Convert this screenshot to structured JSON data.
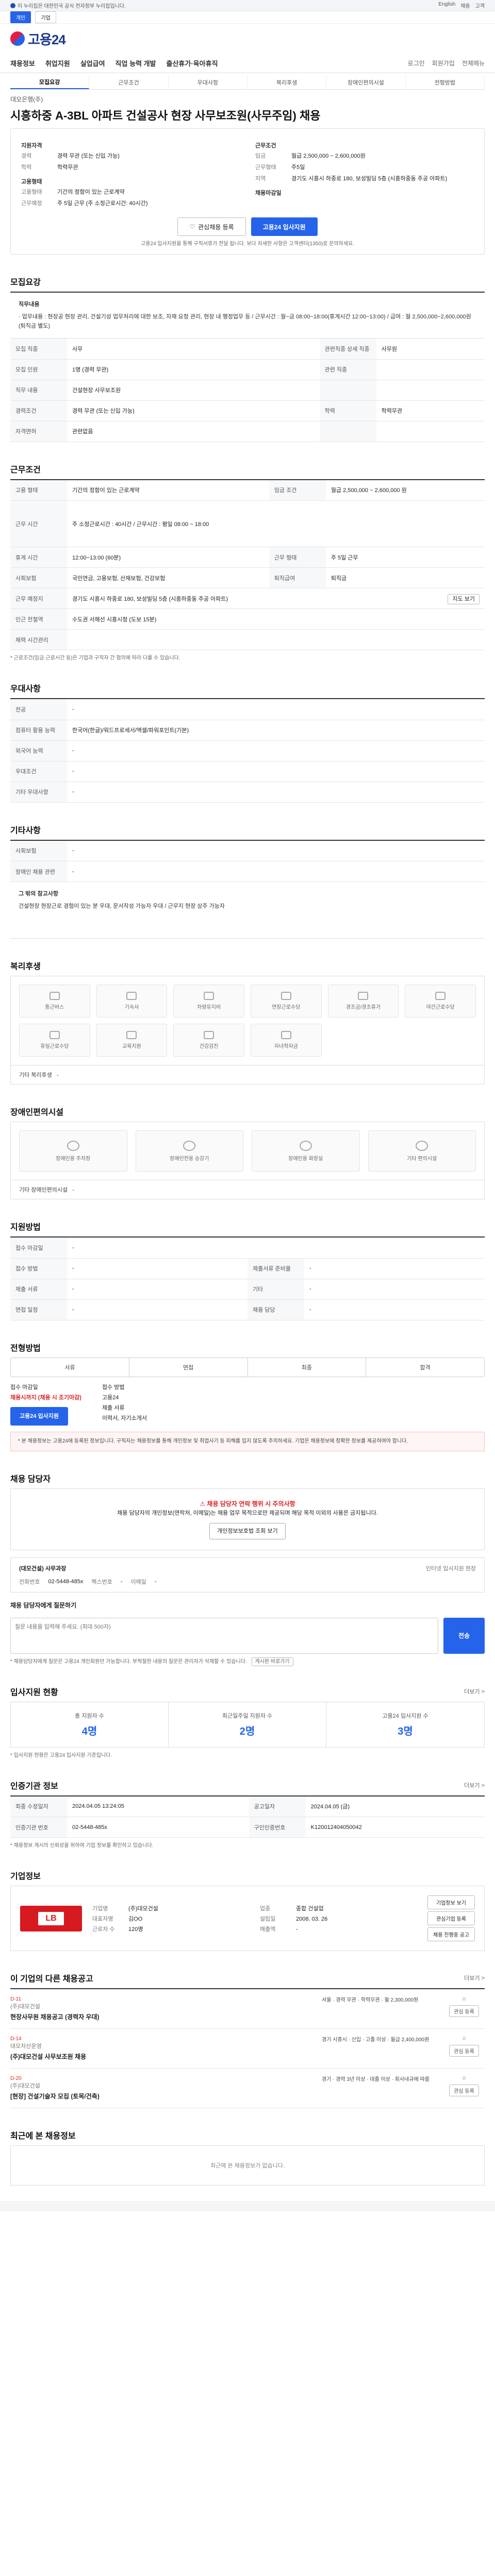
{
  "topbar": {
    "text": "이 누리집은 대한민국 공식 전자정부 누리집입니다.",
    "links": [
      "English",
      "채용",
      "고객"
    ]
  },
  "util": {
    "tabs": [
      "개인",
      "기업"
    ]
  },
  "brand": {
    "name": "고용24"
  },
  "gnb": {
    "items": [
      "채용정보",
      "취업지원",
      "실업급여",
      "직업 능력 개발",
      "출산휴가·육아휴직"
    ],
    "right": [
      "로그인",
      "회원가입",
      "전체메뉴"
    ]
  },
  "tabs": [
    "모집요강",
    "근무조건",
    "우대사항",
    "복리후생",
    "장애인편의시설",
    "전형방법"
  ],
  "job": {
    "company": "대모은행(주)",
    "title": "시흥하중 A-3BL 아파트 건설공사 현장 사무보조원(사무주임) 채용",
    "left": [
      {
        "k": "지원자격",
        "v": ""
      },
      {
        "k": "경력",
        "v": "경력 무관 (또는 신입 가능)"
      },
      {
        "k": "학력",
        "v": "학력무관"
      }
    ],
    "right": [
      {
        "k": "근무조건",
        "v": ""
      },
      {
        "k": "임금",
        "v": "월급 2,500,000 ~ 2,600,000원"
      },
      {
        "k": "근무형태",
        "v": "주5일"
      },
      {
        "k": "지역",
        "v": "경기도 시흥시 하중로 180, 보성빌딩 5층 (시흥하중동 주공 아파트)"
      }
    ],
    "apply_h": "고용형태",
    "apply": [
      {
        "k": "고용형태",
        "v": "기간의 정함이 있는 근로계약"
      },
      {
        "k": "근무예정",
        "v": "주 5일 근무 (주 소정근로시간: 40시간)"
      }
    ],
    "recruit_h": "채용마감일",
    "btn_interest": "관심채용 등록",
    "btn_apply": "고용24 입사지원",
    "note": "고용24 입사지원을 통해 구직서류가 전달 됩니다. 보다 자세한 사항은 고객센터(1350)로 문의하세요."
  },
  "sec_recruit": {
    "title": "모집요강",
    "detail_lbl": "직무내용",
    "detail": "· 업무내용 : 현장공 현장 관리, 건설기성 업무처리에 대한 보조, 자재 요청 관리, 현장 내 행정업무 등 / 근무시간 : 월~금 08:00~18:00(휴게시간 12:00~13:00) / 급여 : 월 2,500,000~2,600,000원 (퇴직금 별도)",
    "rows": [
      {
        "k": "모집 직종",
        "v": "사무",
        "k2": "관련직종 상세 직종",
        "v2": "사무원"
      },
      {
        "k": "모집 인원",
        "v": "1명 (경력 무관)",
        "k2": "관련 직종",
        "v2": ""
      },
      {
        "k": "직무 내용",
        "v": "건설현장 사무보조원",
        "k2": "",
        "v2": ""
      },
      {
        "k": "경력조건",
        "v": "경력 무관 (또는 신입 가능)",
        "k2": "학력",
        "v2": "학력무관"
      },
      {
        "k": "자격면허",
        "v": "관련없음",
        "k2": "",
        "v2": ""
      }
    ]
  },
  "sec_cond": {
    "title": "근무조건",
    "rows": [
      {
        "k": "고용 형태",
        "v": "기간의 정함이 있는 근로계약",
        "k2": "임금 조건",
        "v2": "월급 2,500,000 ~ 2,600,000 원"
      },
      {
        "k": "근무 시간",
        "v": "주 소정근로시간 : 40시간 / 근무시간 : 평일 08:00 ~ 18:00",
        "k2": "",
        "v2": ""
      },
      {
        "k": "휴게 시간",
        "v": "12:00~13:00 (60분)",
        "k2": "근무 형태",
        "v2": "주 5일 근무"
      },
      {
        "k": "사회보험",
        "v": "국민연금, 고용보험, 산재보험, 건강보험",
        "k2": "퇴직급여",
        "v2": "퇴직금"
      },
      {
        "k": "근무 예정지",
        "v": "경기도 시흥시 하중로 180, 보성빌딩 5층 (시흥하중동 주공 아파트)",
        "k2": "",
        "v2": "지도 보기"
      },
      {
        "k": "인근 전철역",
        "v": "수도권 서해선 시흥시청 (도보 15분)",
        "k2": "",
        "v2": ""
      },
      {
        "k": "체력 시간관리",
        "v": "",
        "k2": "",
        "v2": ""
      }
    ],
    "note": "* 근로조건(임금·근로시간 등)은 기업과 구직자 간 협의에 따라 다를 수 있습니다."
  },
  "sec_pref": {
    "title": "우대사항",
    "rows": [
      {
        "k": "전공",
        "v": "-"
      },
      {
        "k": "컴퓨터 활용 능력",
        "v": "한국어(한글)/워드프로세서/엑셀/파워포인트(기본)"
      },
      {
        "k": "외국어 능력",
        "v": "-"
      },
      {
        "k": "우대조건",
        "v": "-"
      },
      {
        "k": "기타 우대사항",
        "v": "-"
      }
    ]
  },
  "sec_etc": {
    "title": "기타사항",
    "rows": [
      {
        "k": "사회보험",
        "v": "-"
      },
      {
        "k": "장애인 채용 관련",
        "v": "-"
      }
    ],
    "detail_lbl": "그 밖의 참고사항",
    "detail": "건설현장 현장근로 경험이 있는 분 우대, 문서작성 가능자 우대 / 근무지 현장 상주 가능자"
  },
  "sec_welfare": {
    "title": "복리후생",
    "items": [
      "통근버스",
      "기숙사",
      "차량유지비",
      "연장근로수당",
      "경조금/경조휴가",
      "야간근로수당",
      "휴일근로수당",
      "교육지원",
      "건강검진",
      "자녀학자금"
    ],
    "etc_k": "기타 복리후생",
    "etc_v": "-"
  },
  "sec_facility": {
    "title": "장애인편의시설",
    "items": [
      "장애인용 주차장",
      "장애인전용 승강기",
      "장애인용 화장실",
      "기타 편의시설"
    ],
    "etc_k": "기타 장애인편의시설",
    "etc_v": "-"
  },
  "sec_apply": {
    "title": "지원방법",
    "rows": [
      {
        "k": "접수 마감일",
        "v": "-",
        "k2": "",
        "v2": ""
      },
      {
        "k": "접수 방법",
        "v": "-",
        "k2": "제출서류 준비물",
        "v2": "-"
      },
      {
        "k": "제출 서류",
        "v": "-",
        "k2": "기타",
        "v2": "-"
      },
      {
        "k": "면접 일정",
        "v": "-",
        "k2": "채용 담당",
        "v2": "-"
      }
    ]
  },
  "sec_select": {
    "title": "전형방법",
    "steps": [
      "서류",
      "면접",
      "최종",
      "합격"
    ],
    "lines": [
      "접수 마감일",
      "채용시까지 (채용 시 조기마감)",
      "고용24 입사지원"
    ],
    "lines2": [
      "접수 방법",
      "고용24",
      "제출 서류",
      "이력서, 자기소개서"
    ],
    "apply_btn": "고용24 입사지원",
    "notes": "* 본 채용정보는 고용24에 등록된 정보입니다. 구직자는 채용정보를 통해 개인정보 및 취업사기 등 피해를 입지 않도록 주의하세요. 기업은 채용정보에 정확한 정보를 제공하여야 합니다."
  },
  "sec_mgr": {
    "title": "채용 담당자",
    "warn": "채용 담당자 연락 행위 시 주의사항",
    "warn_body": "채용 담당자의 개인정보(연락처, 이메일)는 채용 업무 목적으로만 제공되며 해당 목적 이외의 사용은 금지됩니다.",
    "out_btn": "개인정보보호법 조회 보기",
    "mgr_name": "(대모건설) 사무과장",
    "mgr_label": "인터넷 입사지원 현장",
    "phone_k": "전화번호",
    "phone": "02-5448-485x",
    "fax_k": "팩스번호",
    "fax": "-",
    "email_k": "이메일",
    "email": "-",
    "q_label": "채용 담당자에게 질문하기",
    "q_ph": "질문 내용을 입력해 주세요. (최대 500자)",
    "send": "전송",
    "q_notes": "* 채용담당자에게 질문은 고용24 개인회원만 가능합니다. 부적절한 내용의 질문은 관리자가 삭제할 수 있습니다.",
    "q_more": "게시판 바로가기"
  },
  "sec_stats": {
    "title": "입사지원 현황",
    "more": "더보기 >",
    "items": [
      {
        "lab": "총 지원자 수",
        "num": "4명"
      },
      {
        "lab": "최근일주일 지원자 수",
        "num": "2명"
      },
      {
        "lab": "고용24 입사지원 수",
        "num": "3명"
      }
    ],
    "note": "* 입사지원 현황은 고용24 입사지원 기준입니다."
  },
  "sec_reg": {
    "title": "인증기관 정보",
    "more": "더보기 >",
    "rows": [
      {
        "k": "최종 수정일자",
        "v": "2024.04.05 13:24:05",
        "k2": "공고일자",
        "v2": "2024.04.05 (금)"
      },
      {
        "k": "인증기관 번호",
        "v": "02-5448-485x",
        "k2": "구인인증번호",
        "v2": "K120012404050042"
      }
    ],
    "note": "* 채용정보 게시의 신뢰성을 위하여 기업 정보를 확인하고 있습니다."
  },
  "sec_company": {
    "title": "기업정보",
    "logo": "LB",
    "rows": [
      {
        "k": "기업명",
        "v": "(주)대모건설"
      },
      {
        "k": "업종",
        "v": "종합 건설업"
      },
      {
        "k": "대표자명",
        "v": "김OO"
      },
      {
        "k": "설립일",
        "v": "2008. 03. 26"
      },
      {
        "k": "근로자 수",
        "v": "120명"
      },
      {
        "k": "매출액",
        "v": "-"
      }
    ],
    "btns": [
      "기업정보 보기",
      "관심기업 등록",
      "채용 진행중 공고"
    ]
  },
  "sec_jobs": {
    "title": "이 기업의 다른 채용공고",
    "more": "더보기 >",
    "items": [
      {
        "co": "(주)대모건설",
        "tt": "현장사무원 채용공고 (경력자 우대)",
        "m": "서울 · 경력 무관 · 학력무관 · 월 2,300,000원",
        "d": "D-11",
        "b": "관심 등록"
      },
      {
        "co": "대모자산운영",
        "tt": "(주)대모건설 사무보조원 채용",
        "m": "경기 시흥시 · 신입 · 고졸 이상 · 월급 2,400,000원",
        "d": "D-14",
        "b": "관심 등록"
      },
      {
        "co": "(주)대모건설",
        "tt": "[현장] 건설기술자 모집 (토목/건축)",
        "m": "경기 · 경력 3년 이상 · 대졸 이상 · 회사내규에 따름",
        "d": "D-20",
        "b": "관심 등록"
      }
    ]
  },
  "sec_recent": {
    "title": "최근에 본 채용정보",
    "empty": "최근에 본 채용정보가 없습니다."
  }
}
